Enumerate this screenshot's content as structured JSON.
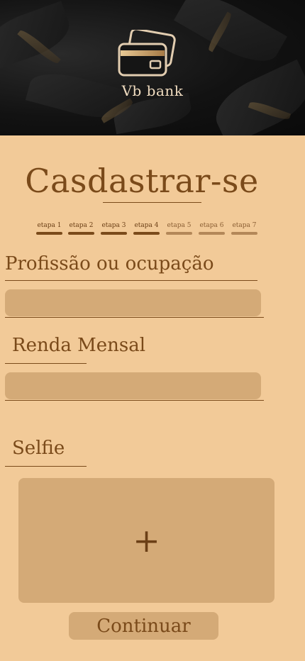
{
  "header": {
    "brand": "Vb bank",
    "logo_icon": "credit-card-icon"
  },
  "page": {
    "title": "Casdastrar-se"
  },
  "steps": [
    {
      "label": "etapa 1",
      "done": true
    },
    {
      "label": "etapa 2",
      "done": true
    },
    {
      "label": "etapa 3",
      "done": true
    },
    {
      "label": "etapa 4",
      "done": true
    },
    {
      "label": "etapa 5",
      "done": false
    },
    {
      "label": "etapa 6",
      "done": false
    },
    {
      "label": "etapa 7",
      "done": false
    }
  ],
  "form": {
    "profession_label": "Profissão ou ocupação",
    "profession_value": "",
    "income_label": "Renda Mensal",
    "income_value": "",
    "selfie_label": "Selfie",
    "selfie_add": "+"
  },
  "actions": {
    "continue_label": "Continuar"
  },
  "colors": {
    "background": "#f2ca98",
    "field": "#d4aa77",
    "text": "#7a4a1a",
    "header_bg": "#121212",
    "accent_gold": "#c9a06a"
  }
}
